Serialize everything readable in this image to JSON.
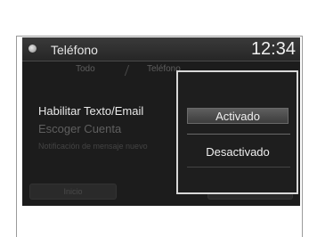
{
  "header": {
    "title": "Teléfono",
    "clock": "12:34"
  },
  "tabs": [
    {
      "label": "Todo"
    },
    {
      "label": "Teléfono"
    }
  ],
  "list": [
    {
      "label": "Habilitar Texto/Email"
    },
    {
      "label": "Escoger Cuenta"
    },
    {
      "label": "Notificación de mensaje nuevo"
    }
  ],
  "bottom": {
    "left_label": "Inicio"
  },
  "popup": {
    "options": [
      {
        "label": "Activado",
        "selected": true
      },
      {
        "label": "Desactivado",
        "selected": false
      }
    ]
  }
}
